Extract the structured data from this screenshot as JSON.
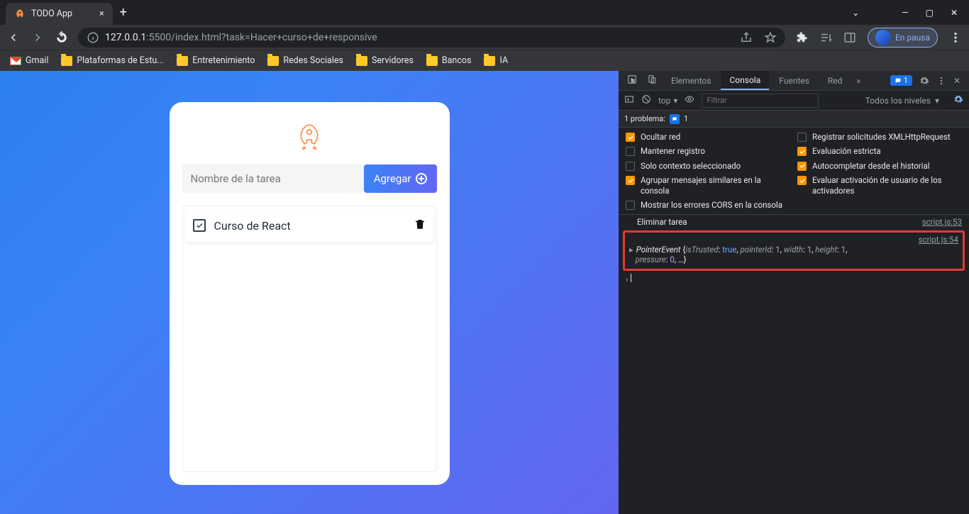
{
  "titlebar": {
    "tab_title": "TODO App",
    "close": "×",
    "newtab": "+",
    "minimize": "—",
    "maximize": "▢",
    "win_close": "✕",
    "chevron": "⌄"
  },
  "toolbar": {
    "url_host": "127.0.0.1",
    "url_port": ":5500",
    "url_path": "/index.html?task=Hacer+curso+de+responsive",
    "pause_label": "En pausa"
  },
  "bookmarks": {
    "items": [
      {
        "label": "Gmail",
        "type": "gmail"
      },
      {
        "label": "Plataformas de Estu...",
        "type": "folder"
      },
      {
        "label": "Entretenimiento",
        "type": "folder"
      },
      {
        "label": "Redes Sociales",
        "type": "folder"
      },
      {
        "label": "Servidores",
        "type": "folder"
      },
      {
        "label": "Bancos",
        "type": "folder"
      },
      {
        "label": "IA",
        "type": "folder"
      }
    ]
  },
  "todo": {
    "placeholder": "Nombre de la tarea",
    "add_label": "Agregar",
    "tasks": [
      {
        "text": "Curso de React",
        "checked": true
      }
    ]
  },
  "devtools": {
    "tabs": {
      "elements": "Elementos",
      "console": "Consola",
      "sources": "Fuentes",
      "network": "Red"
    },
    "msg_count": "1",
    "toolbar": {
      "top": "top",
      "filter_ph": "Filtrar",
      "levels": "Todos los niveles"
    },
    "problems": {
      "label": "1 problema:",
      "count": "1"
    },
    "checks": [
      {
        "label": "Ocultar red",
        "on": true
      },
      {
        "label": "Registrar solicitudes XMLHttpRequest",
        "on": false
      },
      {
        "label": "Mantener registro",
        "on": false
      },
      {
        "label": "Evaluación estricta",
        "on": true
      },
      {
        "label": "Solo contexto seleccionado",
        "on": false
      },
      {
        "label": "Autocompletar desde el historial",
        "on": true
      },
      {
        "label": "Agrupar mensajes similares en la consola",
        "on": true
      },
      {
        "label": "Evaluar activación de usuario de los activadores",
        "on": true
      },
      {
        "label": "Mostrar los errores CORS en la consola",
        "on": false
      }
    ],
    "logs": {
      "line1_text": "Eliminar tarea",
      "line1_src": "script.js:53",
      "line2_src": "script.js:54",
      "obj_name": "PointerEvent",
      "p1k": "isTrusted",
      "p1v": "true",
      "p2k": "pointerId",
      "p2v": "1",
      "p3k": "width",
      "p3v": "1",
      "p4k": "height",
      "p4v": "1",
      "p5k": "pressure",
      "p5v": "0",
      "ellipsis": "…",
      "prompt": "›"
    }
  }
}
